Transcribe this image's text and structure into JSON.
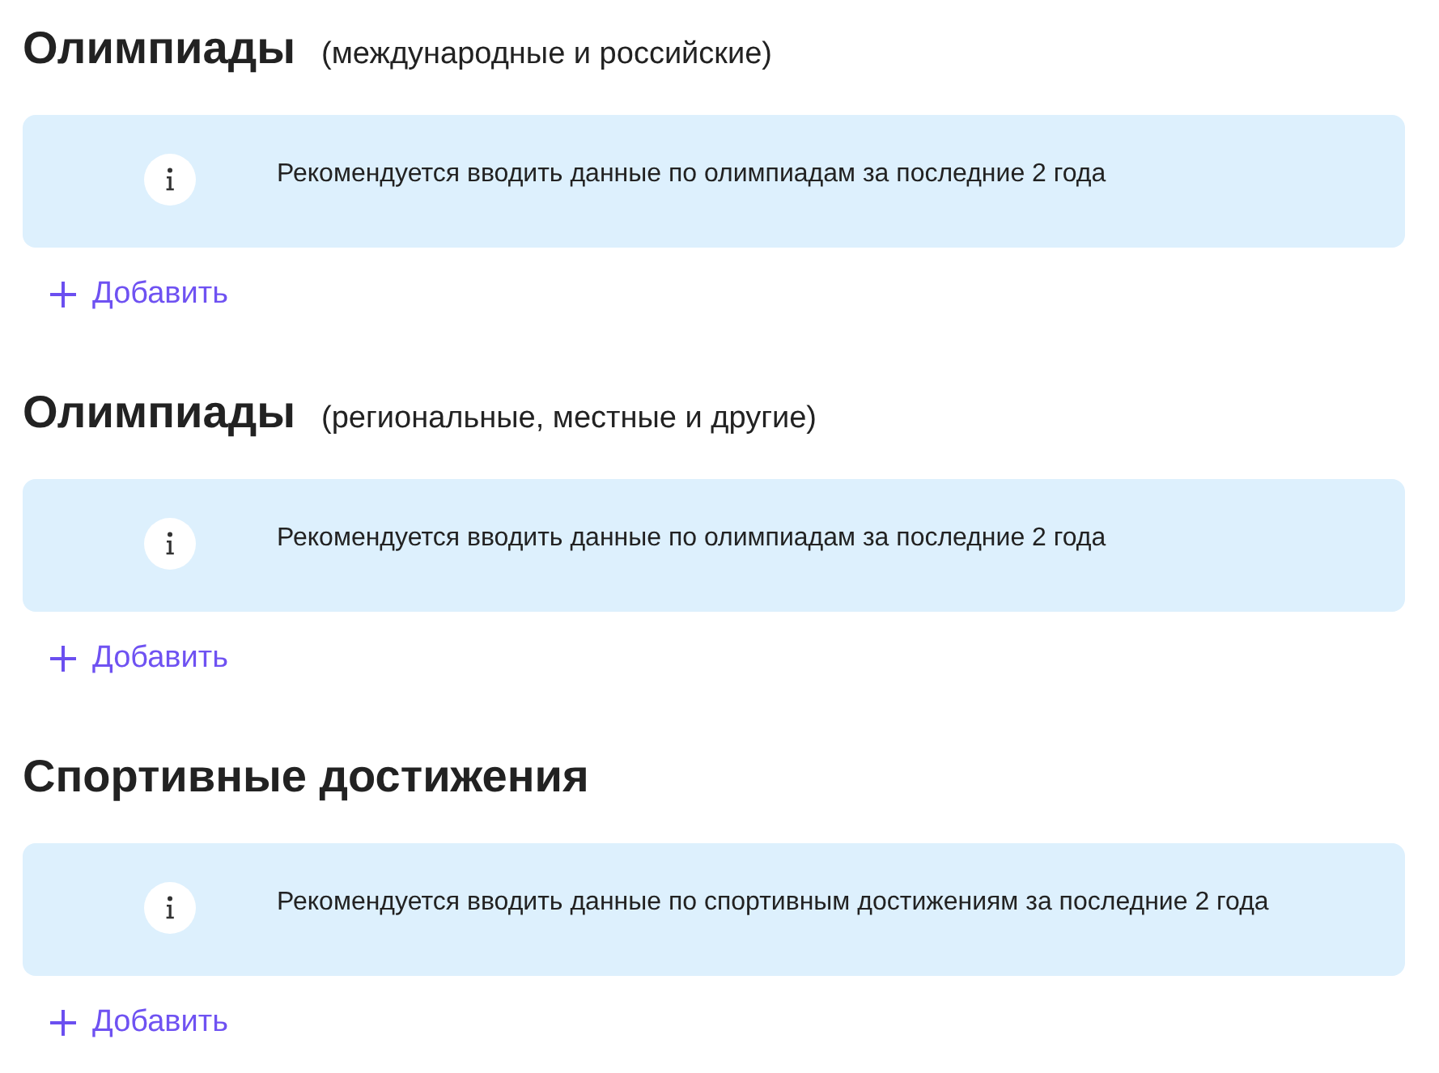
{
  "sections": [
    {
      "title": "Олимпиады",
      "subtitle": "(международные и российские)",
      "notice": "Рекомендуется вводить данные по олимпиадам за последние 2 года",
      "add_button": "Добавить"
    },
    {
      "title": "Олимпиады",
      "subtitle": "(региональные, местные и другие)",
      "notice": "Рекомендуется вводить данные по олимпиадам за последние 2 года",
      "add_button": "Добавить"
    },
    {
      "title": "Спортивные достижения",
      "notice": "Рекомендуется вводить данные по спортивным достижениям за последние 2 года",
      "add_button": "Добавить"
    }
  ]
}
